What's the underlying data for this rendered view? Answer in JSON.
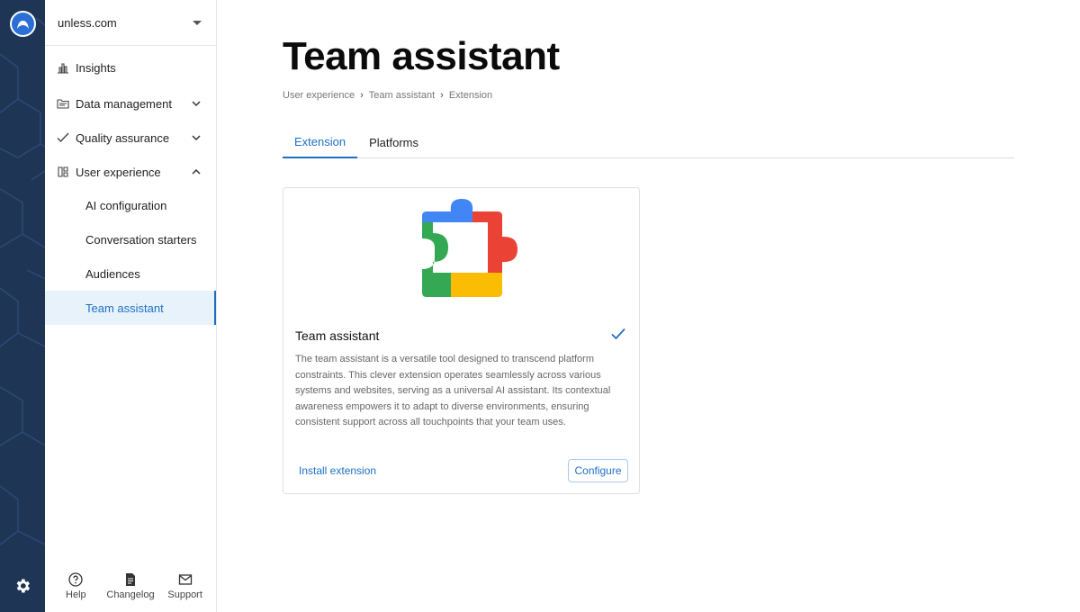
{
  "sidebar": {
    "workspace": "unless.com",
    "nav": [
      {
        "label": "Insights"
      },
      {
        "label": "Data management"
      },
      {
        "label": "Quality assurance"
      },
      {
        "label": "User experience"
      }
    ],
    "sub_items": [
      {
        "label": "AI configuration"
      },
      {
        "label": "Conversation starters"
      },
      {
        "label": "Audiences"
      },
      {
        "label": "Team assistant",
        "active": true
      }
    ],
    "footer": [
      {
        "label": "Help",
        "icon": "help-icon"
      },
      {
        "label": "Changelog",
        "icon": "changelog-icon"
      },
      {
        "label": "Support",
        "icon": "support-icon"
      }
    ]
  },
  "page": {
    "title": "Team assistant",
    "breadcrumb": [
      "User experience",
      "Team assistant",
      "Extension"
    ],
    "tabs": [
      {
        "label": "Extension",
        "active": true
      },
      {
        "label": "Platforms",
        "active": false
      }
    ]
  },
  "card": {
    "title": "Team assistant",
    "description": "The team assistant is a versatile tool designed to transcend platform constraints. This clever extension operates seamlessly across various systems and websites, serving as a universal AI assistant. Its contextual awareness empowers it to adapt to diverse environments, ensuring consistent support across all touchpoints that your team uses.",
    "install_label": "Install extension",
    "configure_label": "Configure",
    "installed": true
  },
  "colors": {
    "accent": "#1e6fc4",
    "rail": "#1f3556",
    "active_bg": "#e8f2fb",
    "puzzle_blue": "#4285f4",
    "puzzle_red": "#ea4335",
    "puzzle_green": "#34a853",
    "puzzle_yellow": "#fbbc04"
  }
}
